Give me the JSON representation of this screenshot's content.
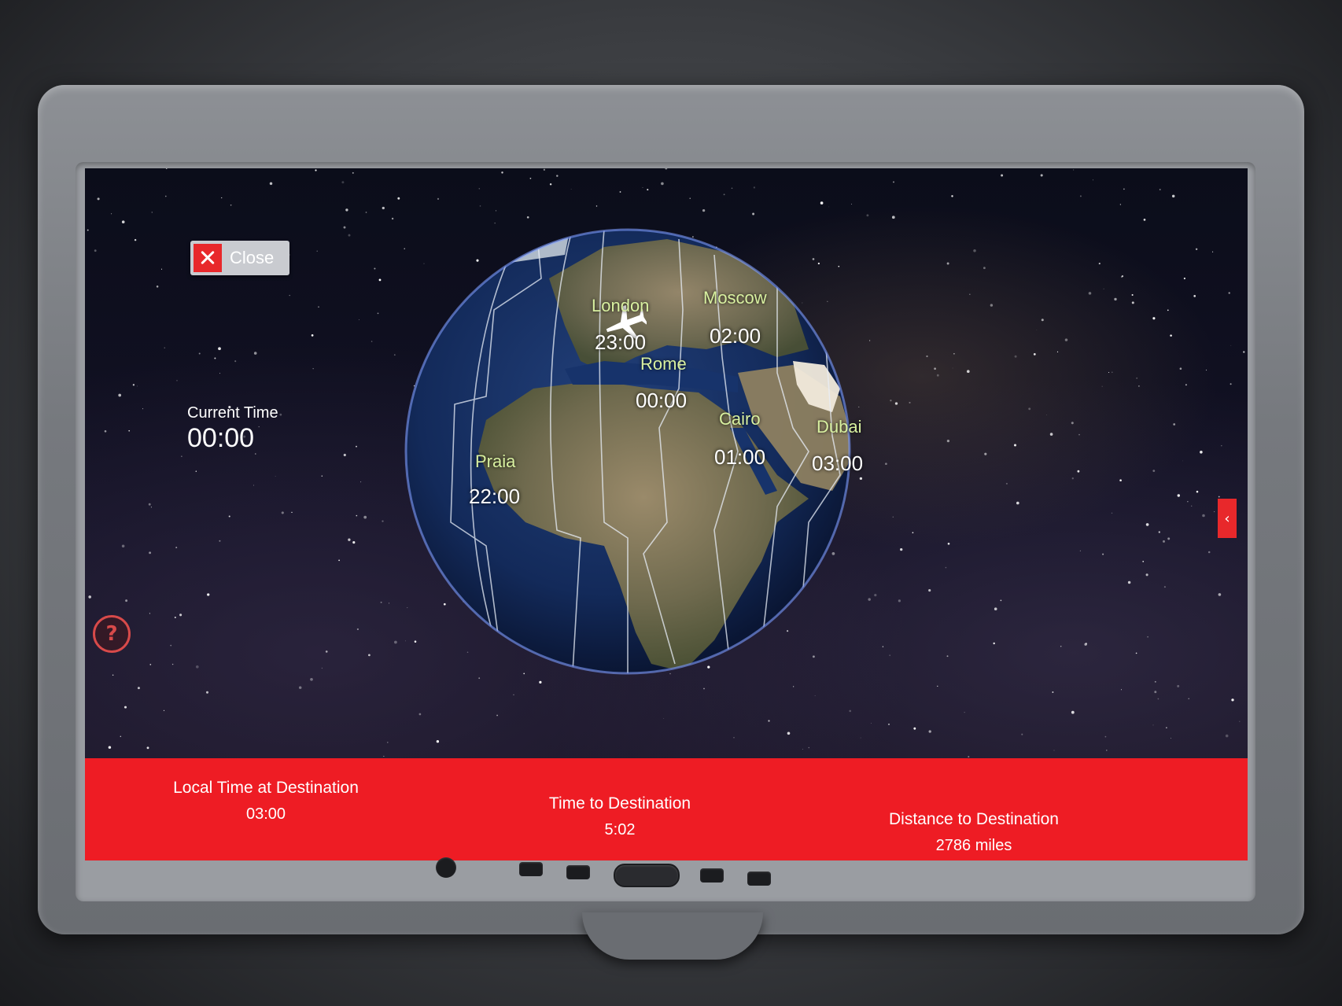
{
  "close_button": {
    "label": "Close",
    "icon": "close-icon"
  },
  "current_time": {
    "label": "Current Time",
    "value": "00:00"
  },
  "help_button": {
    "icon": "help-icon",
    "symbol": "?"
  },
  "side_tab": {
    "icon": "chevron-left-icon",
    "symbol": "‹"
  },
  "map": {
    "plane_icon": "plane-icon",
    "cities": [
      {
        "name": "London",
        "time": "23:00"
      },
      {
        "name": "Moscow",
        "time": "02:00"
      },
      {
        "name": "Rome",
        "time": "00:00"
      },
      {
        "name": "Cairo",
        "time": "01:00"
      },
      {
        "name": "Dubai",
        "time": "03:00"
      },
      {
        "name": "Praia",
        "time": "22:00"
      }
    ]
  },
  "info_bar": {
    "local_time": {
      "label": "Local Time at Destination",
      "value": "03:00"
    },
    "time_to_destination": {
      "label": "Time to Destination",
      "value": "5:02"
    },
    "distance": {
      "label": "Distance to Destination",
      "value": "2786 miles"
    }
  },
  "colors": {
    "accent": "#ee1c24",
    "city_label": "#d8f0a0",
    "globe_glow": "#6e8cff"
  }
}
